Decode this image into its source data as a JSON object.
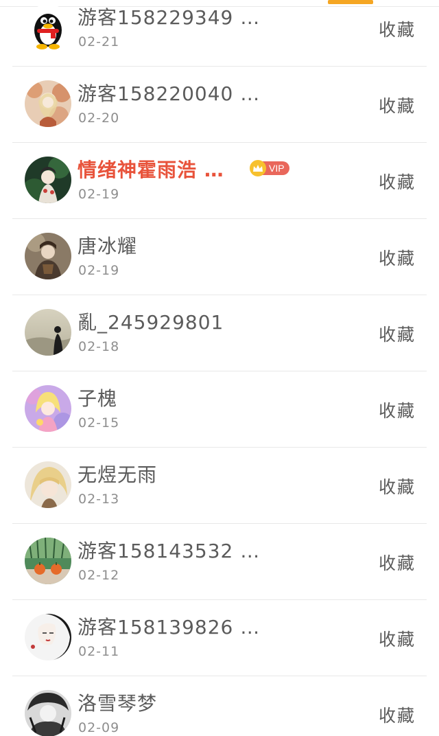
{
  "fav_label": "收藏",
  "accent_color": "#f5a623",
  "vip_color": "#e8533b",
  "rows": [
    {
      "name": "游客158229349 …",
      "date": "02-21",
      "avatar": "penguin-icon"
    },
    {
      "name": "游客158220040 …",
      "date": "02-20",
      "avatar": "avatar-autumn"
    },
    {
      "name": "情绪神霍雨浩 …",
      "date": "02-19",
      "avatar": "avatar-anime-green",
      "vip": true,
      "vip_label": "VIP"
    },
    {
      "name": "唐冰耀",
      "date": "02-19",
      "avatar": "avatar-warrior"
    },
    {
      "name": "亂_245929801",
      "date": "02-18",
      "avatar": "avatar-silhouette"
    },
    {
      "name": "子槐",
      "date": "02-15",
      "avatar": "avatar-pink-anime"
    },
    {
      "name": "无煜无雨",
      "date": "02-13",
      "avatar": "avatar-blonde"
    },
    {
      "name": "游客158143532 …",
      "date": "02-12",
      "avatar": "avatar-oranges"
    },
    {
      "name": "游客158139826 …",
      "date": "02-11",
      "avatar": "avatar-ink-girl"
    },
    {
      "name": "洛雪琴梦",
      "date": "02-09",
      "avatar": "avatar-monochrome"
    }
  ]
}
